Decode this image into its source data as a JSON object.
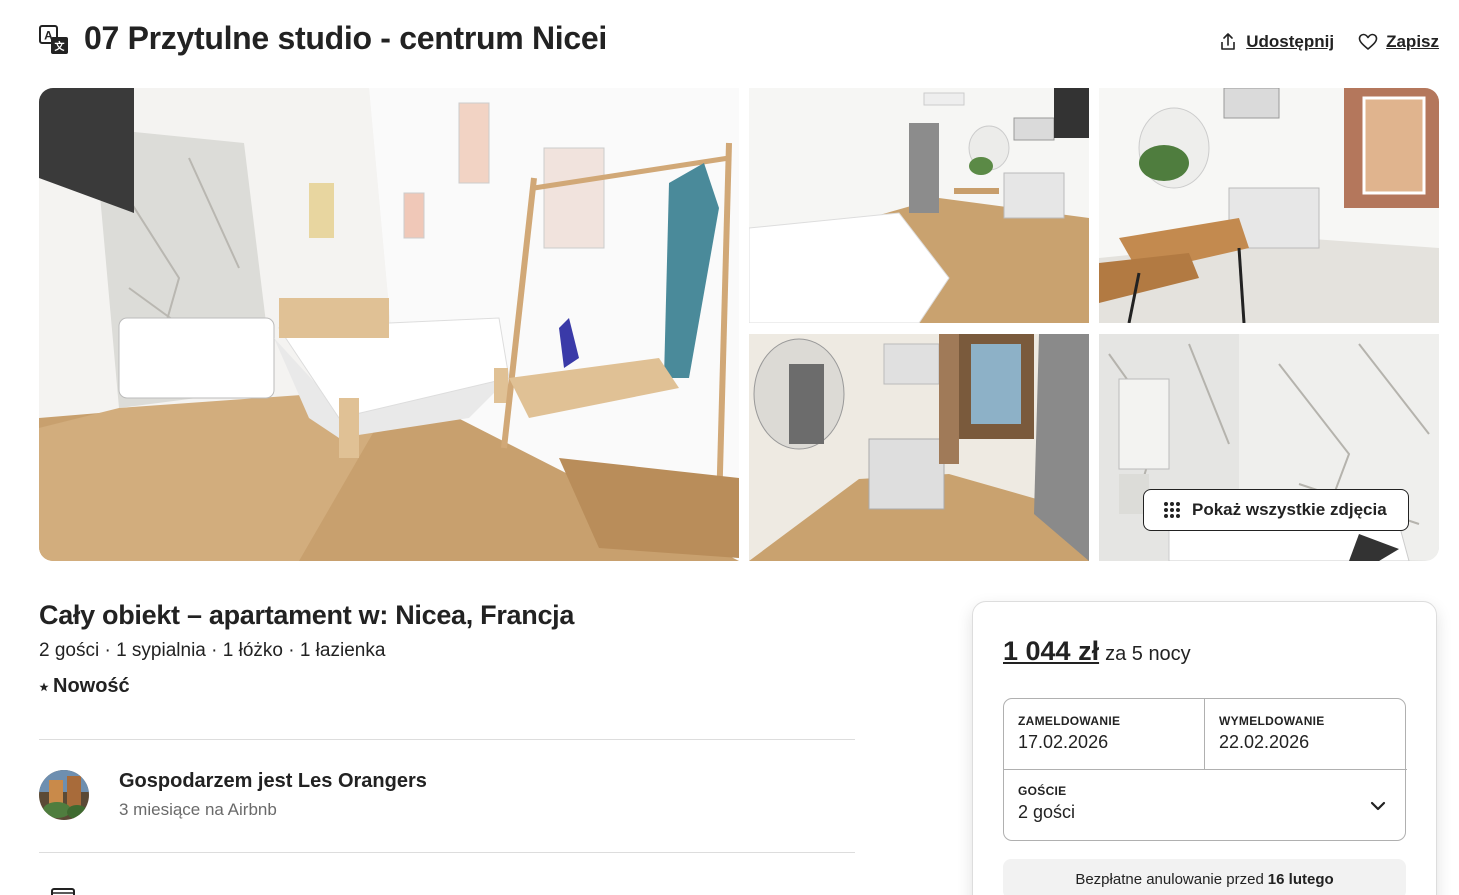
{
  "header": {
    "title": "07 Przytulne studio - centrum Nicei",
    "share_label": "Udostępnij",
    "save_label": "Zapisz"
  },
  "gallery": {
    "show_all_label": "Pokaż wszystkie zdjęcia"
  },
  "listing": {
    "type_title": "Cały obiekt – apartament w: Nicea, Francja",
    "meta": "2 gości · 1 sypialnia · 1 łóżko · 1 łazienka",
    "badge": "Nowość"
  },
  "host": {
    "name": "Gospodarzem jest Les Orangers",
    "tenure": "3 miesiące na Airbnb"
  },
  "booking": {
    "price": "1 044 zł",
    "period": "za 5 nocy",
    "checkin_label": "ZAMELDOWANIE",
    "checkin_value": "17.02.2026",
    "checkout_label": "WYMELDOWANIE",
    "checkout_value": "22.02.2026",
    "guests_label": "GOŚCIE",
    "guests_value": "2 gości",
    "cancel_prefix": "Bezpłatne anulowanie przed",
    "cancel_date": "16 lutego"
  },
  "colors": {
    "text": "#222222",
    "muted": "#6a6a6a",
    "border": "#dddddd",
    "wood": "#c8a06e"
  }
}
